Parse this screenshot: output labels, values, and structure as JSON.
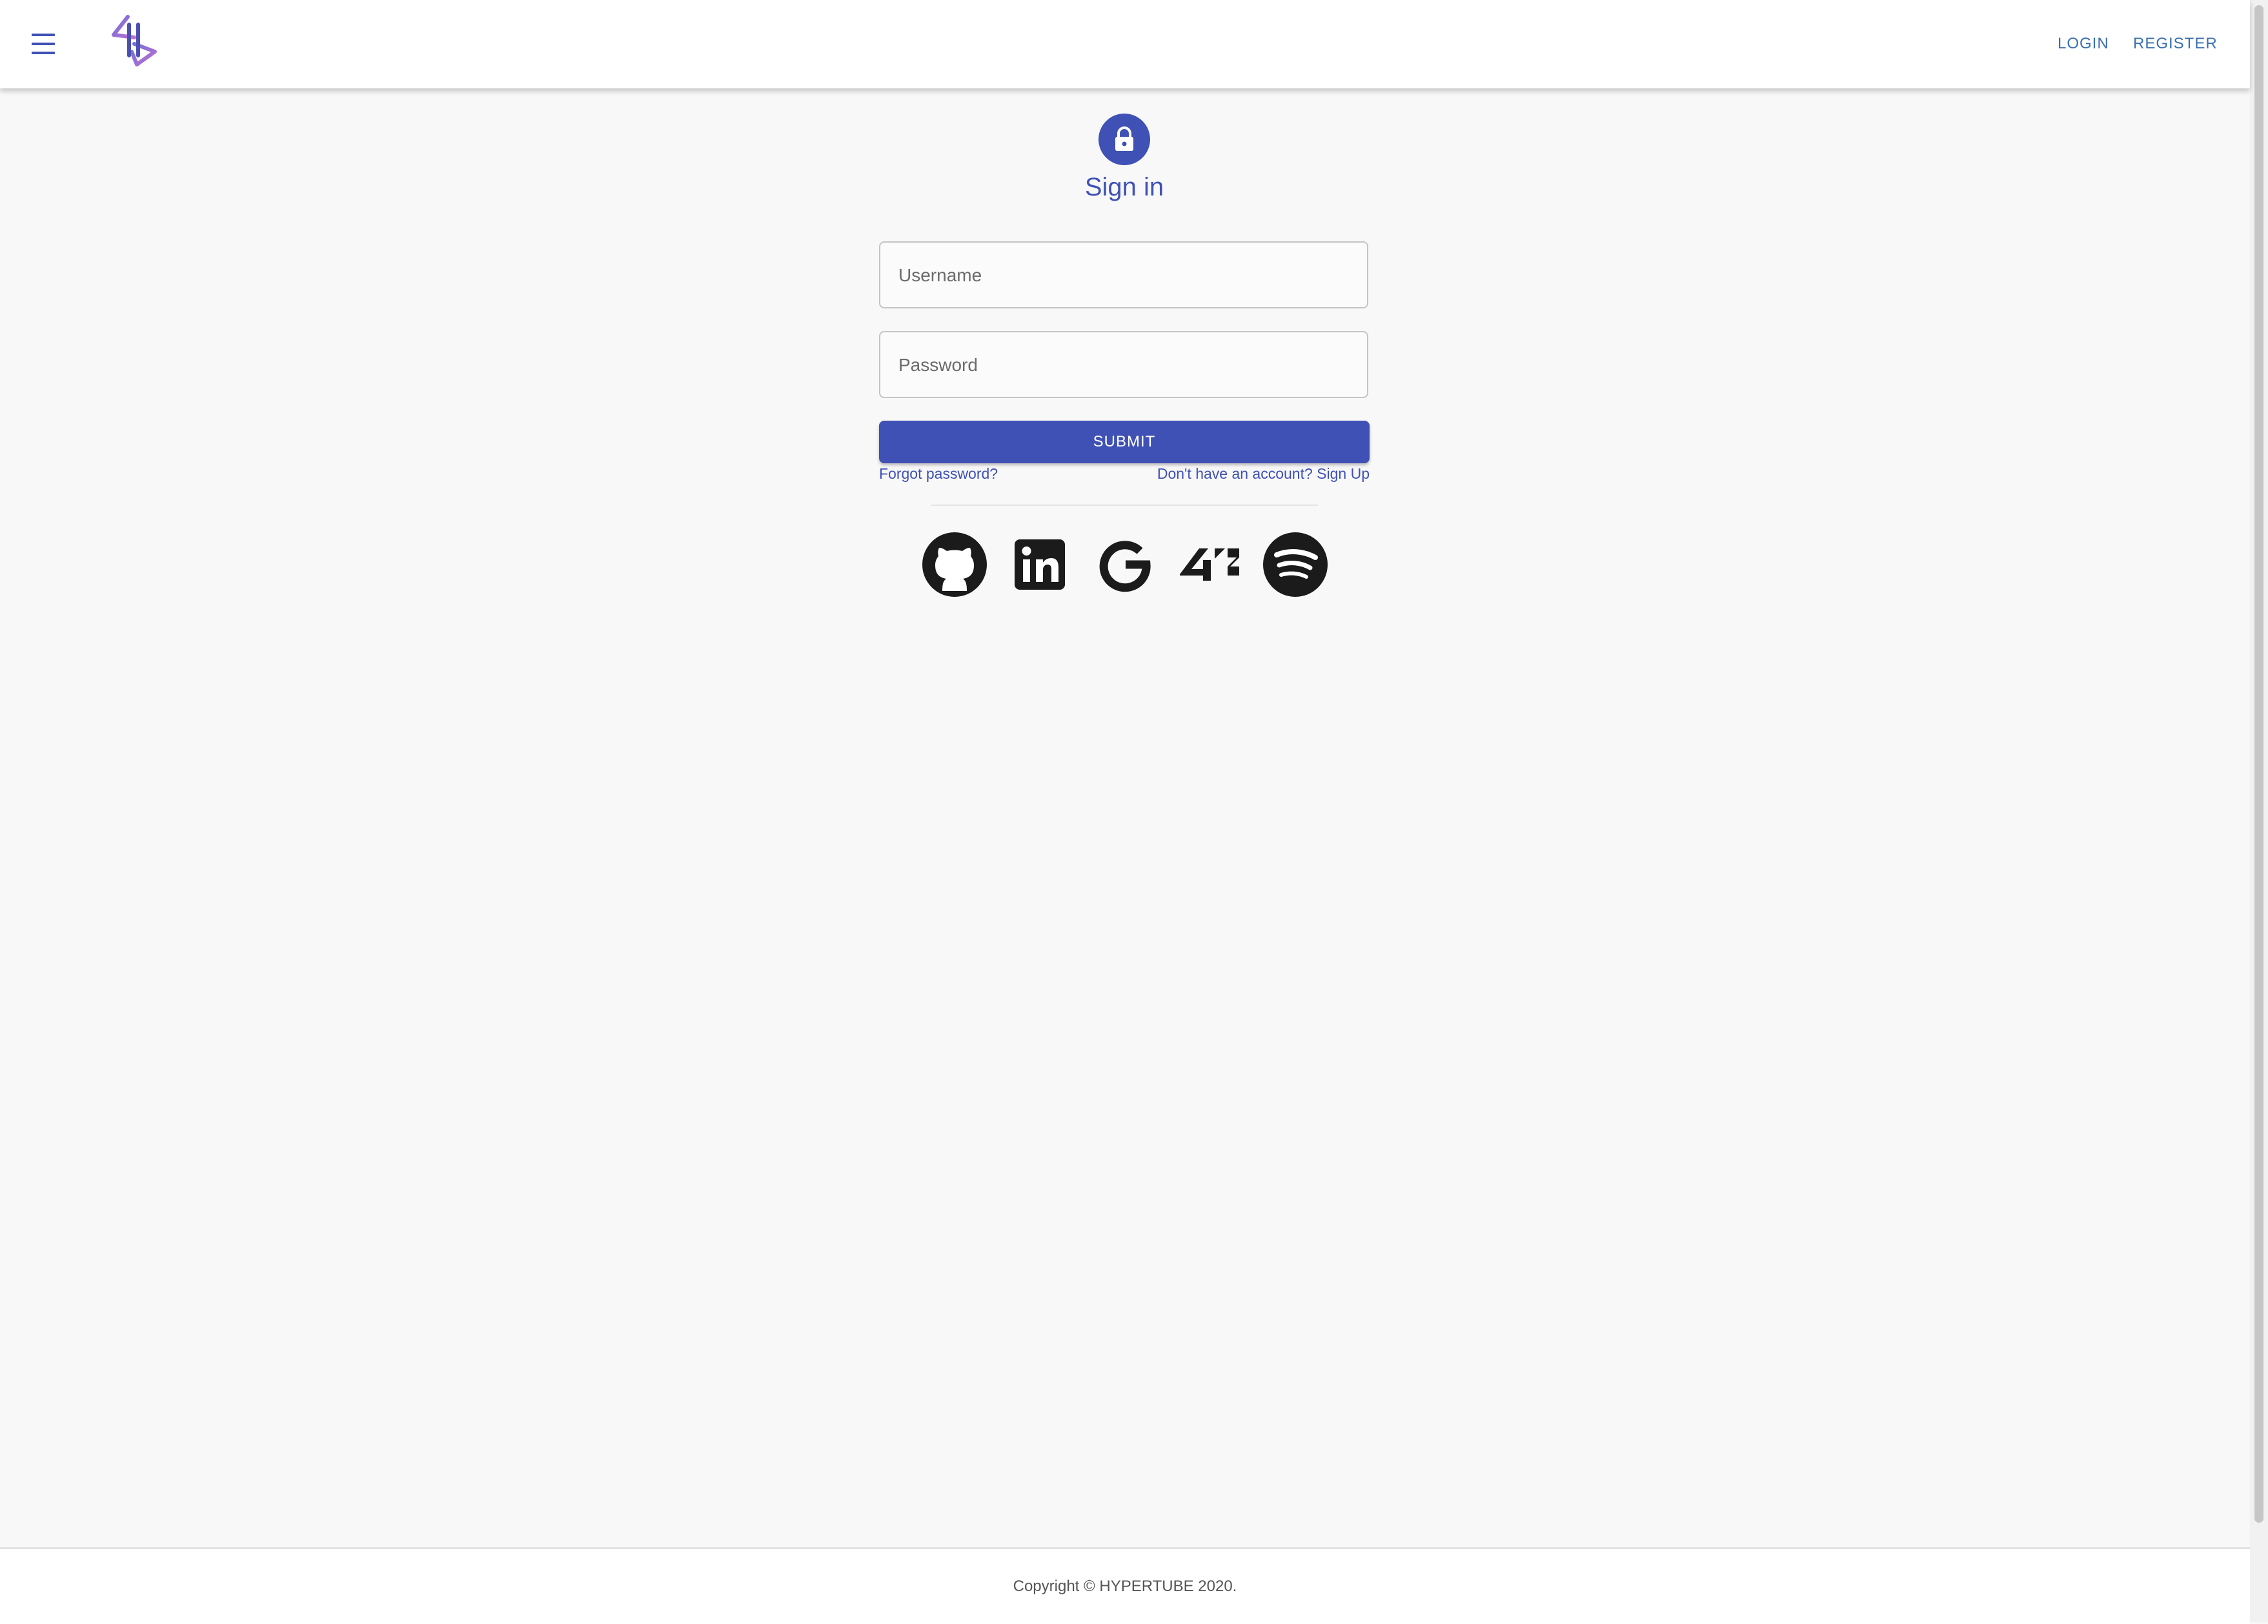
{
  "header": {
    "login_label": "LOGIN",
    "register_label": "REGISTER"
  },
  "signin": {
    "title": "Sign in",
    "username_placeholder": "Username",
    "password_placeholder": "Password",
    "submit_label": "SUBMIT",
    "forgot_label": "Forgot password?",
    "signup_label": "Don't have an account? Sign Up"
  },
  "social": [
    "github-icon",
    "linkedin-icon",
    "google-icon",
    "42-icon",
    "spotify-icon"
  ],
  "footer": {
    "copyright": "Copyright © HYPERTUBE 2020."
  },
  "colors": {
    "primary": "#3f51b5",
    "background": "#f8f8f8",
    "nav_link": "#3a6fb0"
  }
}
